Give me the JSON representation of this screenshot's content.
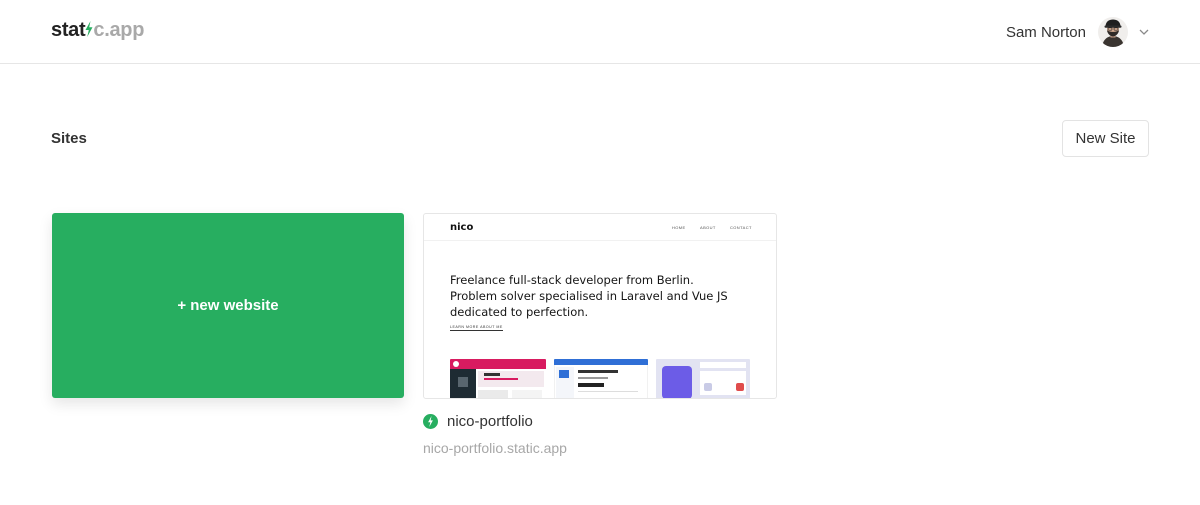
{
  "header": {
    "logo_part1": "stat",
    "logo_part2": "c.app",
    "user_name": "Sam Norton",
    "avatar_icon": "user-avatar",
    "menu_icon": "chevron-down-icon"
  },
  "page": {
    "title": "Sites",
    "new_site_label": "New Site"
  },
  "new_tile": {
    "label": "+ new website",
    "color": "#27ae60"
  },
  "sites": [
    {
      "name": "nico-portfolio",
      "url": "nico-portfolio.static.app",
      "status_icon": "bolt-icon",
      "status_color": "#27ae60",
      "preview": {
        "logo": "nico",
        "nav": [
          "HOME",
          "ABOUT",
          "CONTACT"
        ],
        "hero_line1": "Freelance full-stack developer from Berlin.",
        "hero_line2": "Problem solver specialised in Laravel and Vue JS",
        "hero_line3": "dedicated to perfection.",
        "link": "LEARN MORE ABOUT ME"
      }
    }
  ]
}
